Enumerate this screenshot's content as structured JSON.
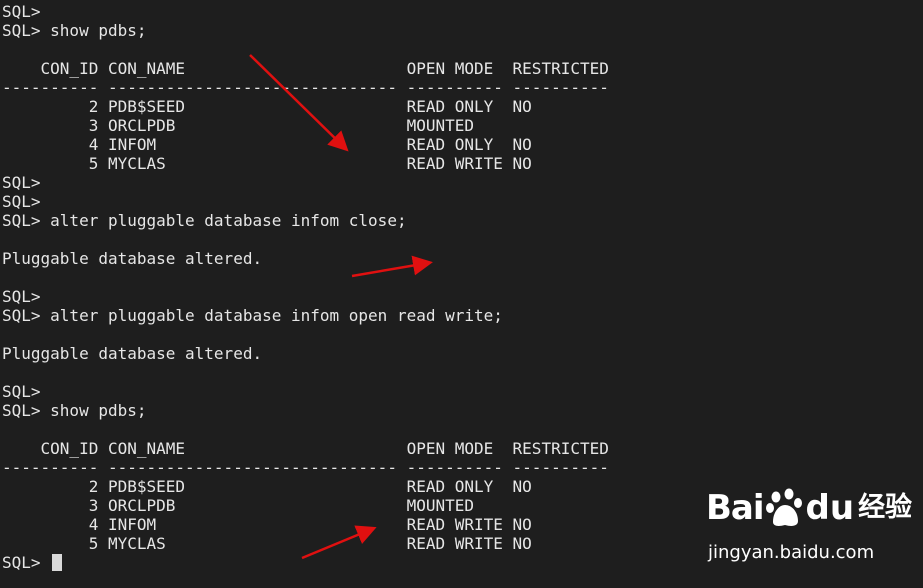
{
  "terminal": {
    "lines": [
      "SQL>",
      "SQL> show pdbs;",
      "",
      "    CON_ID CON_NAME                       OPEN MODE  RESTRICTED",
      "---------- ------------------------------ ---------- ----------",
      "         2 PDB$SEED                       READ ONLY  NO",
      "         3 ORCLPDB                        MOUNTED",
      "         4 INFOM                          READ ONLY  NO",
      "         5 MYCLAS                         READ WRITE NO",
      "SQL>",
      "SQL>",
      "SQL> alter pluggable database infom close;",
      "",
      "Pluggable database altered.",
      "",
      "SQL>",
      "SQL> alter pluggable database infom open read write;",
      "",
      "Pluggable database altered.",
      "",
      "SQL>",
      "SQL> show pdbs;",
      "",
      "    CON_ID CON_NAME                       OPEN MODE  RESTRICTED",
      "---------- ------------------------------ ---------- ----------",
      "         2 PDB$SEED                       READ ONLY  NO",
      "         3 ORCLPDB                        MOUNTED",
      "         4 INFOM                          READ WRITE NO",
      "         5 MYCLAS                         READ WRITE NO"
    ],
    "prompt": "SQL> "
  },
  "watermark": {
    "brand_prefix": "Bai",
    "brand_suffix": "du",
    "brand_cn": "经验",
    "url": "jingyan.baidu.com"
  },
  "colors": {
    "background": "#1e1e1e",
    "text": "#e6e6e6",
    "arrow": "#e01010",
    "cursor": "#d9d9d9"
  },
  "icons": [
    "annotation-arrow",
    "baidu-paw-icon"
  ]
}
